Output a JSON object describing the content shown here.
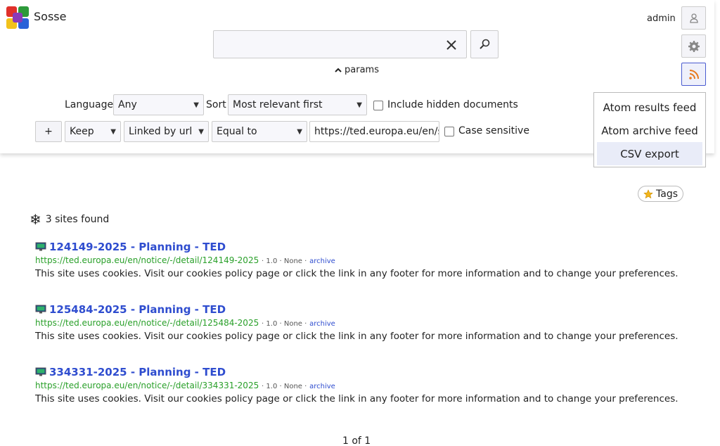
{
  "app": {
    "name": "Sosse"
  },
  "search": {
    "placeholder": "",
    "value": "",
    "params_label": "params"
  },
  "user": {
    "name": "admin"
  },
  "feed_menu": {
    "items": [
      "Atom results feed",
      "Atom archive feed",
      "CSV export"
    ]
  },
  "filters": {
    "language_label": "Language",
    "language_value": "Any",
    "sort_label": "Sort",
    "sort_value": "Most relevant first",
    "include_hidden_label": "Include hidden documents",
    "add_label": "+",
    "keep_value": "Keep",
    "field_value": "Linked by url",
    "op_value": "Equal to",
    "url_value": "https://ted.europa.eu/en/sear",
    "case_label": "Case sensitive"
  },
  "tags": {
    "label": "Tags"
  },
  "results_summary": "3 sites found",
  "results": [
    {
      "title": "124149-2025 - Planning - TED",
      "url": "https://ted.europa.eu/en/notice/-/detail/124149-2025",
      "score": "· 1.0 · None ·",
      "archive": "archive",
      "desc": "This site uses cookies. Visit our cookies policy page or click the link in any footer for more information and to change your preferences."
    },
    {
      "title": "125484-2025 - Planning - TED",
      "url": "https://ted.europa.eu/en/notice/-/detail/125484-2025",
      "score": "· 1.0 · None ·",
      "archive": "archive",
      "desc": "This site uses cookies. Visit our cookies policy page or click the link in any footer for more information and to change your preferences."
    },
    {
      "title": "334331-2025 - Planning - TED",
      "url": "https://ted.europa.eu/en/notice/-/detail/334331-2025",
      "score": "· 1.0 · None ·",
      "archive": "archive",
      "desc": "This site uses cookies. Visit our cookies policy page or click the link in any footer for more information and to change your preferences."
    }
  ],
  "pager": "1 of 1",
  "colors": {
    "link": "#2f4dcf",
    "url": "#2aa02a",
    "accent": "#4a5bd0"
  }
}
